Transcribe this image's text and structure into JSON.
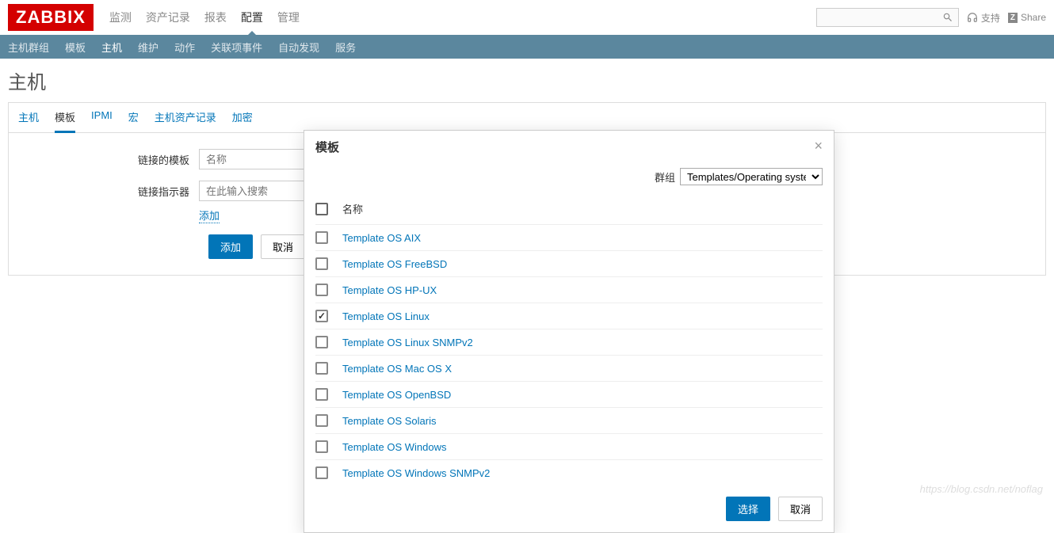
{
  "header": {
    "logo": "ZABBIX",
    "nav": [
      "监测",
      "资产记录",
      "报表",
      "配置",
      "管理"
    ],
    "nav_active_index": 3,
    "support": "支持",
    "share": "Share"
  },
  "subnav": {
    "items": [
      "主机群组",
      "模板",
      "主机",
      "维护",
      "动作",
      "关联项事件",
      "自动发现",
      "服务"
    ],
    "active_index": 2
  },
  "page": {
    "title": "主机",
    "tabs": [
      "主机",
      "模板",
      "IPMI",
      "宏",
      "主机资产记录",
      "加密"
    ],
    "tabs_active_index": 1
  },
  "form": {
    "linked_templates_label": "链接的模板",
    "linked_templates_placeholder": "名称",
    "link_new_label": "链接指示器",
    "search_placeholder": "在此输入搜索",
    "add_link": "添加",
    "submit": "添加",
    "cancel": "取消"
  },
  "modal": {
    "title": "模板",
    "group_label": "群组",
    "group_value": "Templates/Operating systems",
    "name_header": "名称",
    "templates": [
      {
        "name": "Template OS AIX",
        "checked": false
      },
      {
        "name": "Template OS FreeBSD",
        "checked": false
      },
      {
        "name": "Template OS HP-UX",
        "checked": false
      },
      {
        "name": "Template OS Linux",
        "checked": true
      },
      {
        "name": "Template OS Linux SNMPv2",
        "checked": false
      },
      {
        "name": "Template OS Mac OS X",
        "checked": false
      },
      {
        "name": "Template OS OpenBSD",
        "checked": false
      },
      {
        "name": "Template OS Solaris",
        "checked": false
      },
      {
        "name": "Template OS Windows",
        "checked": false
      },
      {
        "name": "Template OS Windows SNMPv2",
        "checked": false
      }
    ],
    "select_button": "选择",
    "cancel_button": "取消"
  },
  "watermark": "https://blog.csdn.net/noflag"
}
